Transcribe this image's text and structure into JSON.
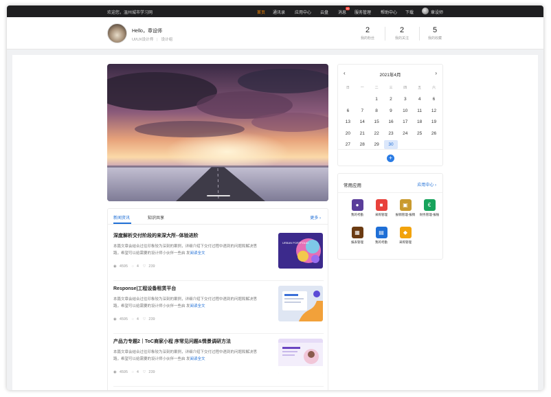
{
  "topbar": {
    "welcome": "欢迎您，温州城市学习网",
    "nav": [
      {
        "label": "首页",
        "active": true
      },
      {
        "label": "通讯录",
        "active": false
      },
      {
        "label": "应用中心",
        "active": false
      },
      {
        "label": "云盘",
        "active": false
      },
      {
        "label": "消息",
        "active": false,
        "badge": "99"
      },
      {
        "label": "服务管理",
        "active": false
      },
      {
        "label": "帮助中心",
        "active": false
      },
      {
        "label": "下载",
        "active": false
      }
    ],
    "username": "章设师"
  },
  "profile": {
    "greeting": "Hello，章设师",
    "tag1": "UI/UX设计师",
    "tag2": "设计组",
    "stats": [
      {
        "value": "2",
        "label": "我的粉丝"
      },
      {
        "value": "2",
        "label": "我的关注"
      },
      {
        "value": "5",
        "label": "我的收藏"
      }
    ]
  },
  "news": {
    "tabs": [
      "新闻资讯",
      "知识共享"
    ],
    "more": "更多",
    "articles": [
      {
        "title": "深度解析交付阶段的来深大所--体验进阶",
        "desc": "本篇文章会结合过往印象较为深刻的案例，详细介绍下交付过程中遇到的问题和解决思路，希望可以给需要的设计师小伙伴一些启 发",
        "readmore": "阅读全文",
        "views": "4595",
        "comments": "4",
        "likes": "239"
      },
      {
        "title": "Response|工程设备租赁平台",
        "desc": "本篇文章会结合过往印象较为深刻的案例，详细介绍下交付过程中遇到的问题和解决思路，希望可以给需要的设计师小伙伴一些启 发",
        "readmore": "阅读全文",
        "views": "4595",
        "comments": "4",
        "likes": "239"
      },
      {
        "title": "产品力专题2｜ToC商家小程 序常见问题&情景调研方法",
        "desc": "本篇文章会结合过往印象较为深刻的案例，详细介绍下交付过程中遇到的问题和解决思路，希望可以给需要的设计师小伙伴一些启 发",
        "readmore": "阅读全文",
        "views": "4595",
        "comments": "4",
        "likes": "239"
      }
    ],
    "thumb1_text": "URBAN PORTFOLIO"
  },
  "calendar": {
    "title": "2021年4月",
    "weekdays": [
      "日",
      "一",
      "二",
      "三",
      "四",
      "五",
      "六"
    ],
    "weeks": [
      [
        "",
        "",
        "",
        "",
        "1",
        "2",
        "3"
      ],
      [
        "4",
        "5",
        "6",
        "7",
        "8",
        "9",
        "10"
      ],
      [
        "11",
        "12",
        "13",
        "14",
        "15",
        "16",
        "17"
      ],
      [
        "18",
        "19",
        "20",
        "21",
        "22",
        "23",
        "24"
      ],
      [
        "25",
        "26",
        "27",
        "28",
        "29",
        "30",
        ""
      ]
    ],
    "shown_rows": [
      [
        "",
        "",
        "1",
        "2",
        "3",
        "4",
        "6"
      ],
      [
        "6",
        "7",
        "8",
        "9",
        "10",
        "11",
        "12"
      ],
      [
        "13",
        "14",
        "15",
        "16",
        "17",
        "18",
        "19"
      ],
      [
        "20",
        "21",
        "22",
        "23",
        "24",
        "25",
        "26"
      ],
      [
        "27",
        "28",
        "29",
        "30",
        "",
        "",
        ""
      ]
    ],
    "selected": "30",
    "add_symbol": "+"
  },
  "apps": {
    "title": "常用应用",
    "center": "应用中心",
    "items": [
      {
        "label": "我的考勤",
        "color": "#5a3d9a",
        "glyph": "●"
      },
      {
        "label": "采购管理",
        "color": "#e8413b",
        "glyph": "■"
      },
      {
        "label": "报销管理-报销",
        "color": "#c99a2e",
        "glyph": "▣"
      },
      {
        "label": "财务管理-报账",
        "color": "#17a35b",
        "glyph": "€"
      },
      {
        "label": "报表管理",
        "color": "#6b3b12",
        "glyph": "▦"
      },
      {
        "label": "我的考勤",
        "color": "#1f6fd6",
        "glyph": "▤"
      },
      {
        "label": "采购管理",
        "color": "#f2a30c",
        "glyph": "◆"
      }
    ]
  }
}
